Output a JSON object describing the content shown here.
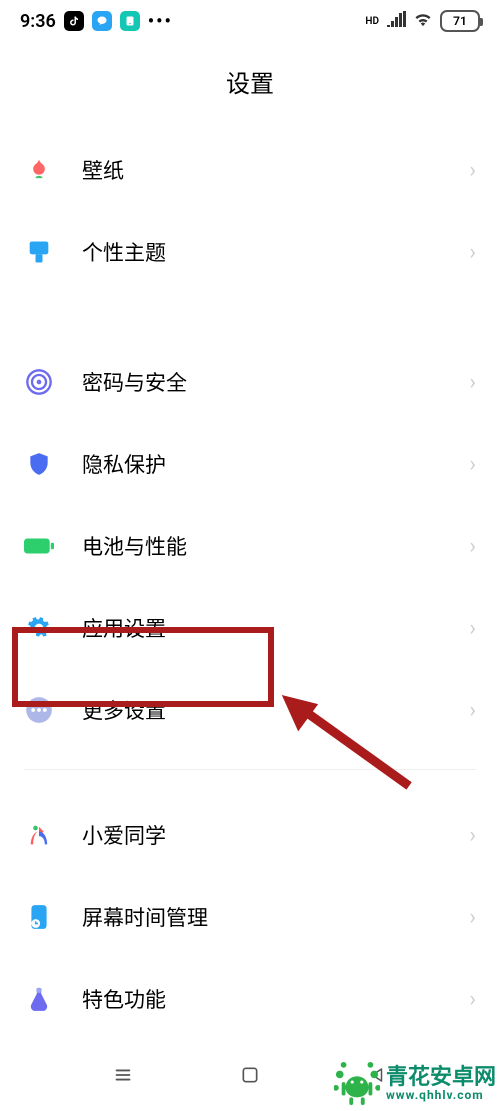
{
  "status_bar": {
    "time": "9:36",
    "hd_label": "HD",
    "battery": "71"
  },
  "page": {
    "title": "设置"
  },
  "group1": [
    {
      "key": "wallpaper",
      "label": "壁纸"
    },
    {
      "key": "theme",
      "label": "个性主题"
    }
  ],
  "group2": [
    {
      "key": "password",
      "label": "密码与安全"
    },
    {
      "key": "privacy",
      "label": "隐私保护"
    },
    {
      "key": "battery",
      "label": "电池与性能"
    },
    {
      "key": "apps",
      "label": "应用设置"
    },
    {
      "key": "more",
      "label": "更多设置"
    }
  ],
  "group3": [
    {
      "key": "xiaoai",
      "label": "小爱同学"
    },
    {
      "key": "screentime",
      "label": "屏幕时间管理"
    },
    {
      "key": "special",
      "label": "特色功能"
    }
  ],
  "watermark": {
    "brand": "青花安卓网",
    "url": "www.qhhlv.com"
  }
}
